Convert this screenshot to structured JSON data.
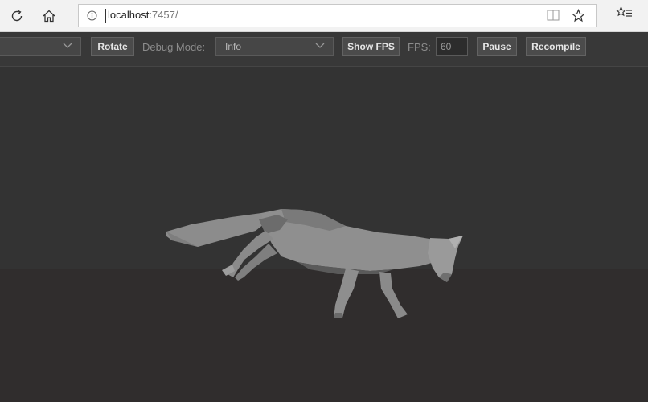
{
  "browser": {
    "url_host": "localhost",
    "url_port": ":7457/",
    "icons": {
      "refresh": "refresh-icon",
      "home": "home-icon",
      "info": "info-icon",
      "reader": "reading-view-icon",
      "favorite": "star-icon",
      "favorites": "favorites-list-icon"
    }
  },
  "toolbar": {
    "animation_select_value": "",
    "rotate_label": "Rotate",
    "debug_mode_label": "Debug Mode:",
    "debug_mode_value": "Info",
    "show_fps_label": "Show FPS",
    "fps_label": "FPS:",
    "fps_value": "60",
    "pause_label": "Pause",
    "recompile_label": "Recompile"
  },
  "colors": {
    "toolbar_bg": "#383838",
    "viewport_bg": "#333333",
    "floor": "#302d2d",
    "model": "#8a8a8a"
  }
}
